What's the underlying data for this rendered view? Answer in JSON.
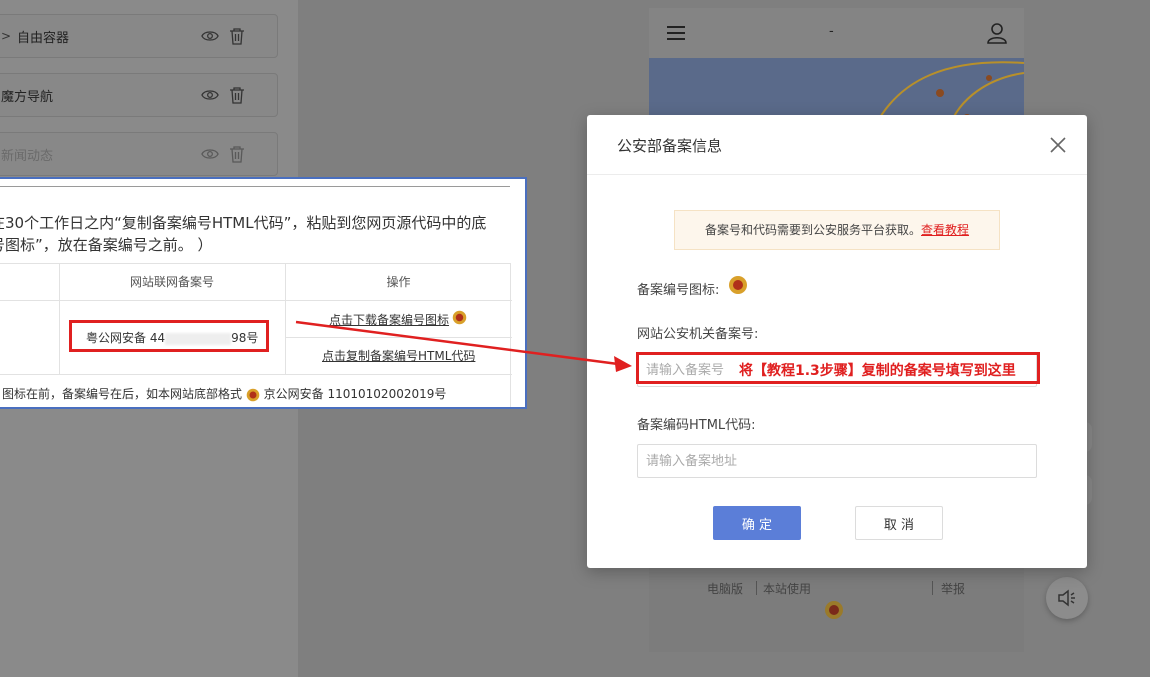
{
  "left_panel": {
    "items": [
      {
        "label": "自由容器"
      },
      {
        "label": "魔方导航"
      },
      {
        "label": "新闻动态"
      }
    ]
  },
  "phone": {
    "title": "-",
    "footer_links": [
      "电脑版",
      "本站使用",
      "举报"
    ]
  },
  "overlay": {
    "line1": "在30个工作日之内“复制备案编号HTML代码”，粘贴到您网页源代码中的底",
    "line2": "号图标”，放在备案编号之前。 ）",
    "col_record": "网站联网备案号",
    "col_action": "操作",
    "record_prefix": "粤公网安备 44",
    "record_suffix": "98号",
    "link_download_icon": "点击下载备案编号图标",
    "link_copy_html": "点击复制备案编号HTML代码",
    "note_prefix": "图标在前，备案编号在后，如本网站底部格式",
    "note_suffix": "京公网安备 11010102002019号"
  },
  "modal": {
    "title": "公安部备案信息",
    "notice_text": "备案号和代码需要到公安服务平台获取。",
    "notice_link": "查看教程",
    "icon_label": "备案编号图标:",
    "record_label": "网站公安机关备案号:",
    "record_placeholder": "请输入备案号",
    "html_label": "备案编码HTML代码:",
    "html_placeholder": "请输入备案地址",
    "confirm_label": "确 定",
    "cancel_label": "取 消"
  },
  "annotation": {
    "text": "将【教程1.3步骤】复制的备案号填写到这里",
    "color": "#e02020"
  },
  "colors": {
    "primary_button": "#5b7ed8",
    "notice_bg": "#fdf6ec",
    "overlay_border": "#4a6fbf"
  }
}
